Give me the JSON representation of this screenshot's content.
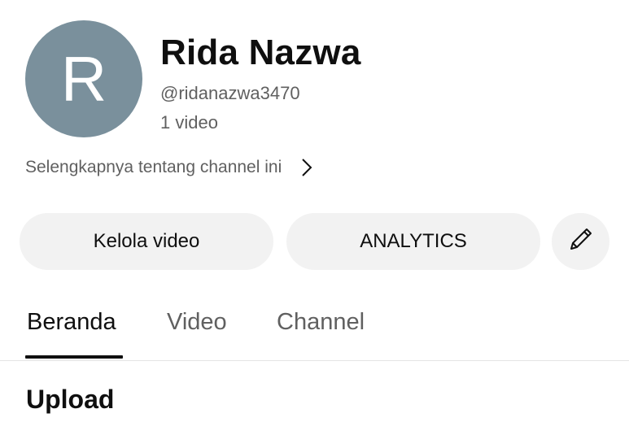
{
  "channel": {
    "avatar_letter": "R",
    "avatar_color": "#7a909c",
    "name": "Rida Nazwa",
    "handle": "@ridanazwa3470",
    "video_count": "1 video"
  },
  "about": {
    "label": "Selengkapnya tentang channel ini",
    "icon": "chevron-right-icon"
  },
  "buttons": {
    "manage_videos": "Kelola video",
    "analytics": "ANALYTICS",
    "edit_icon": "pencil-icon"
  },
  "tabs": [
    {
      "label": "Beranda",
      "active": true
    },
    {
      "label": "Video",
      "active": false
    },
    {
      "label": "Channel",
      "active": false
    }
  ],
  "sections": {
    "upload_title": "Upload"
  }
}
